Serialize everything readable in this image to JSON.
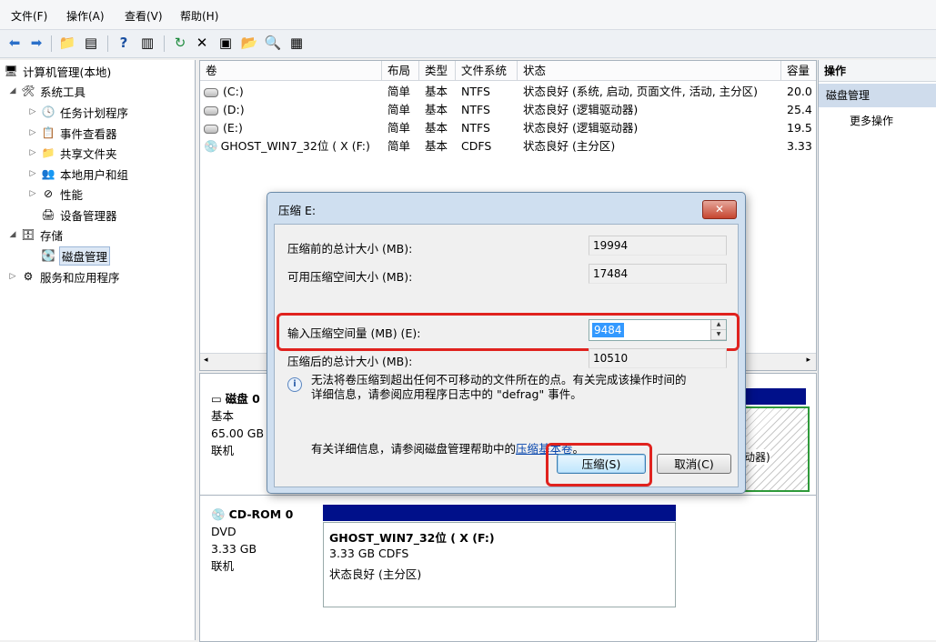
{
  "menu": [
    "文件(F)",
    "操作(A)",
    "查看(V)",
    "帮助(H)"
  ],
  "tree": {
    "root": "计算机管理(本地)",
    "system_tools": "系统工具",
    "task_scheduler": "任务计划程序",
    "event_viewer": "事件查看器",
    "shared_folders": "共享文件夹",
    "local_users": "本地用户和组",
    "performance": "性能",
    "device_manager": "设备管理器",
    "storage": "存储",
    "disk_management": "磁盘管理",
    "services_apps": "服务和应用程序"
  },
  "table": {
    "columns": [
      "卷",
      "布局",
      "类型",
      "文件系统",
      "状态",
      "容量"
    ],
    "rows": [
      [
        "(C:)",
        "简单",
        "基本",
        "NTFS",
        "状态良好 (系统, 启动, 页面文件, 活动, 主分区)",
        "20.0"
      ],
      [
        "(D:)",
        "简单",
        "基本",
        "NTFS",
        "状态良好 (逻辑驱动器)",
        "25.4"
      ],
      [
        "(E:)",
        "简单",
        "基本",
        "NTFS",
        "状态良好 (逻辑驱动器)",
        "19.5"
      ],
      [
        "GHOST_WIN7_32位 ( X (F:)",
        "简单",
        "基本",
        "CDFS",
        "状态良好 (主分区)",
        "3.33"
      ]
    ]
  },
  "actions": {
    "header": "操作",
    "selected": "磁盘管理",
    "more": "更多操作"
  },
  "disks": {
    "disk0_name": "磁盘 0",
    "disk0_type": "基本",
    "disk0_size": "65.00 GB",
    "disk0_status": "联机",
    "disk0_partial_right": "动器)",
    "cdrom_name": "CD-ROM 0",
    "cdrom_type": "DVD",
    "cdrom_size": "3.33 GB",
    "cdrom_status": "联机",
    "cd_part_name": "GHOST_WIN7_32位 ( X  (F:)",
    "cd_part_fs": "3.33 GB CDFS",
    "cd_part_status": "状态良好 (主分区)"
  },
  "dialog": {
    "title": "压缩 E:",
    "close": "✕",
    "label_total_before": "压缩前的总计大小 (MB):",
    "value_total_before": "19994",
    "label_available": "可用压缩空间大小 (MB):",
    "value_available": "17484",
    "label_input": "输入压缩空间量 (MB) (E):",
    "value_input": "9484",
    "label_total_after": "压缩后的总计大小 (MB):",
    "value_total_after": "10510",
    "info_line1": "无法将卷压缩到超出任何不可移动的文件所在的点。有关完成该操作时间的",
    "info_line2": "详细信息，请参阅应用程序日志中的 \"defrag\" 事件。",
    "help_prefix": "有关详细信息，请参阅磁盘管理帮助中的",
    "help_link": "压缩基本卷",
    "help_suffix": "。",
    "shrink_button": "压缩(S)",
    "cancel_button": "取消(C)"
  },
  "colors": {
    "highlight_red": "#e0221e",
    "partition_bar": "#00108a",
    "selection_blue": "#3399ff"
  }
}
